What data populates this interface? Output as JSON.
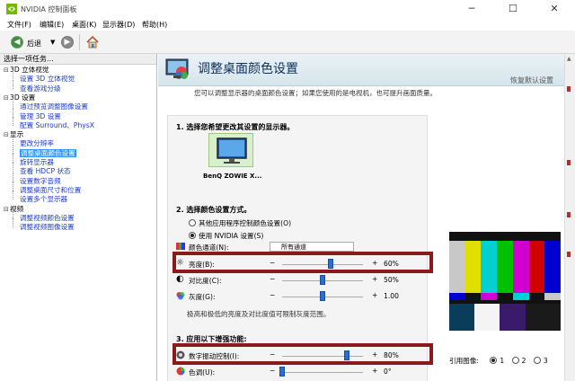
{
  "window": {
    "title": "NVIDIA 控制面板",
    "controls": [
      "─",
      "☐",
      "✕"
    ]
  },
  "menu": [
    "文件(F)",
    "编辑(E)",
    "桌面(K)",
    "显示器(D)",
    "帮助(H)"
  ],
  "toolbar": {
    "back_label": "后退",
    "back_glyph": "◀",
    "forward_glyph": "▶",
    "dropdown_glyph": "▼"
  },
  "left_pane": {
    "header": "选择一项任务...",
    "tree": [
      {
        "type": "category",
        "label": "3D 立体视觉"
      },
      {
        "type": "link",
        "label": "设置 3D 立体视觉"
      },
      {
        "type": "link",
        "label": "查看游戏分级"
      },
      {
        "type": "category",
        "label": "3D 设置"
      },
      {
        "type": "link",
        "label": "通过预览调整图像设置"
      },
      {
        "type": "link",
        "label": "管理 3D 设置"
      },
      {
        "type": "link",
        "label": "配置 Surround、PhysX"
      },
      {
        "type": "category",
        "label": "显示"
      },
      {
        "type": "link",
        "label": "更改分辨率"
      },
      {
        "type": "link",
        "label": "调整桌面颜色设置",
        "selected": true
      },
      {
        "type": "link",
        "label": "旋转显示器"
      },
      {
        "type": "link",
        "label": "查看 HDCP 状态"
      },
      {
        "type": "link",
        "label": "设置数字音频"
      },
      {
        "type": "link",
        "label": "调整桌面尺寸和位置"
      },
      {
        "type": "link",
        "label": "设置多个显示器"
      },
      {
        "type": "category",
        "label": "视频"
      },
      {
        "type": "link",
        "label": "调整视频颜色设置"
      },
      {
        "type": "link",
        "label": "调整视频图像设置"
      }
    ]
  },
  "main": {
    "title": "调整桌面颜色设置",
    "restore_defaults": "恢复默认设置",
    "description": "您可以调整显示器的桌面颜色设置；如果您使用的是电视机，也可提升画面质量。",
    "section1": "1. 选择您希望更改其设置的显示器。",
    "monitor_label": "BenQ ZOWIE X...",
    "section2": "2. 选择颜色设置方式。",
    "radio_other": "其他应用程序控制颜色设置(O)",
    "radio_nvidia": "使用 NVIDIA 设置(S)",
    "channel_label": "颜色通道(N):",
    "channel_value": "所有通道",
    "brightness": {
      "label": "亮度(B):",
      "value": "60%",
      "level": 60
    },
    "contrast": {
      "label": "对比度(C):",
      "value": "50%",
      "level": 50
    },
    "gamma": {
      "label": "灰度(G):",
      "value": "1.00",
      "level": 50
    },
    "range_note": "极高和极低的亮度及对比度值可限制灰度范围。",
    "section3": "3. 应用以下增强功能:",
    "vibrance": {
      "label": "数字振动控制(I):",
      "value": "80%",
      "level": 80
    },
    "hue": {
      "label": "色调(U):",
      "value": "0°",
      "level": 0
    },
    "reference_label": "引用图像:",
    "ref_options": [
      "1",
      "2",
      "3"
    ]
  },
  "colors": {
    "link": "#1a3bd1",
    "selected": "#3297fd",
    "highlight_box": "#8b1a1a",
    "banner_title": "#0b2f57"
  }
}
